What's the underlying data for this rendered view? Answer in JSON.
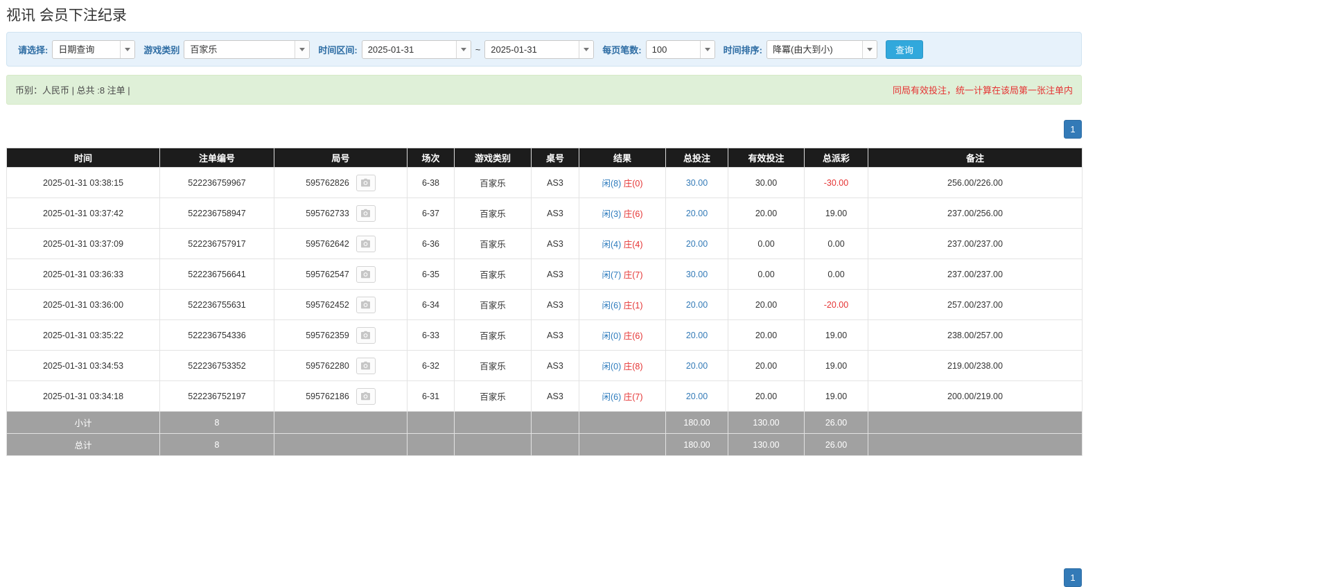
{
  "page": {
    "title": "视讯 会员下注纪录"
  },
  "filters": {
    "select": {
      "label": "请选择:",
      "value": "日期查询"
    },
    "game_type": {
      "label": "游戏类别",
      "value": "百家乐"
    },
    "time_range": {
      "label": "时间区间:",
      "from": "2025-01-31",
      "separator": "~",
      "to": "2025-01-31"
    },
    "page_size": {
      "label": "每页笔数:",
      "value": "100"
    },
    "sort": {
      "label": "时间排序:",
      "value": "降冪(由大到小)"
    },
    "search_label": "查询"
  },
  "summary": {
    "currency_info": "币别：人民币 | 总共 :8 注单 |",
    "notice": "同局有效投注，统一计算在该局第一张注单内"
  },
  "pagination": {
    "page": "1"
  },
  "colors": {
    "accent_blue": "#337ab7",
    "search_button_blue": "#31a8dc",
    "player_blue": "#2d7bbd",
    "banker_red": "#e53333",
    "negative_red": "#e53333",
    "header_bg": "#1c1c1c",
    "footer_bg": "#a1a1a1",
    "filter_bar_bg": "#e7f2fb",
    "summary_bar_bg": "#dff0d8"
  },
  "table": {
    "headers": [
      "时间",
      "注单编号",
      "局号",
      "场次",
      "游戏类别",
      "桌号",
      "结果",
      "总投注",
      "有效投注",
      "总派彩",
      "备注"
    ],
    "replay_icon": "camera-icon",
    "rows": [
      {
        "time": "2025-01-31 03:38:15",
        "bet_id": "522236759967",
        "round_id": "595762826",
        "session": "6-38",
        "game": "百家乐",
        "table_no": "AS3",
        "player": "闲(8)",
        "banker": "庄(0)",
        "total_bet": "30.00",
        "valid_bet": "30.00",
        "payout": "-30.00",
        "remark": "256.00/226.00"
      },
      {
        "time": "2025-01-31 03:37:42",
        "bet_id": "522236758947",
        "round_id": "595762733",
        "session": "6-37",
        "game": "百家乐",
        "table_no": "AS3",
        "player": "闲(3)",
        "banker": "庄(6)",
        "total_bet": "20.00",
        "valid_bet": "20.00",
        "payout": "19.00",
        "remark": "237.00/256.00"
      },
      {
        "time": "2025-01-31 03:37:09",
        "bet_id": "522236757917",
        "round_id": "595762642",
        "session": "6-36",
        "game": "百家乐",
        "table_no": "AS3",
        "player": "闲(4)",
        "banker": "庄(4)",
        "total_bet": "20.00",
        "valid_bet": "0.00",
        "payout": "0.00",
        "remark": "237.00/237.00"
      },
      {
        "time": "2025-01-31 03:36:33",
        "bet_id": "522236756641",
        "round_id": "595762547",
        "session": "6-35",
        "game": "百家乐",
        "table_no": "AS3",
        "player": "闲(7)",
        "banker": "庄(7)",
        "total_bet": "30.00",
        "valid_bet": "0.00",
        "payout": "0.00",
        "remark": "237.00/237.00"
      },
      {
        "time": "2025-01-31 03:36:00",
        "bet_id": "522236755631",
        "round_id": "595762452",
        "session": "6-34",
        "game": "百家乐",
        "table_no": "AS3",
        "player": "闲(6)",
        "banker": "庄(1)",
        "total_bet": "20.00",
        "valid_bet": "20.00",
        "payout": "-20.00",
        "remark": "257.00/237.00"
      },
      {
        "time": "2025-01-31 03:35:22",
        "bet_id": "522236754336",
        "round_id": "595762359",
        "session": "6-33",
        "game": "百家乐",
        "table_no": "AS3",
        "player": "闲(0)",
        "banker": "庄(6)",
        "total_bet": "20.00",
        "valid_bet": "20.00",
        "payout": "19.00",
        "remark": "238.00/257.00"
      },
      {
        "time": "2025-01-31 03:34:53",
        "bet_id": "522236753352",
        "round_id": "595762280",
        "session": "6-32",
        "game": "百家乐",
        "table_no": "AS3",
        "player": "闲(0)",
        "banker": "庄(8)",
        "total_bet": "20.00",
        "valid_bet": "20.00",
        "payout": "19.00",
        "remark": "219.00/238.00"
      },
      {
        "time": "2025-01-31 03:34:18",
        "bet_id": "522236752197",
        "round_id": "595762186",
        "session": "6-31",
        "game": "百家乐",
        "table_no": "AS3",
        "player": "闲(6)",
        "banker": "庄(7)",
        "total_bet": "20.00",
        "valid_bet": "20.00",
        "payout": "19.00",
        "remark": "200.00/219.00"
      }
    ],
    "footer": [
      {
        "label": "小计",
        "count": "8",
        "total_bet": "180.00",
        "valid_bet": "130.00",
        "payout": "26.00"
      },
      {
        "label": "总计",
        "count": "8",
        "total_bet": "180.00",
        "valid_bet": "130.00",
        "payout": "26.00"
      }
    ]
  }
}
